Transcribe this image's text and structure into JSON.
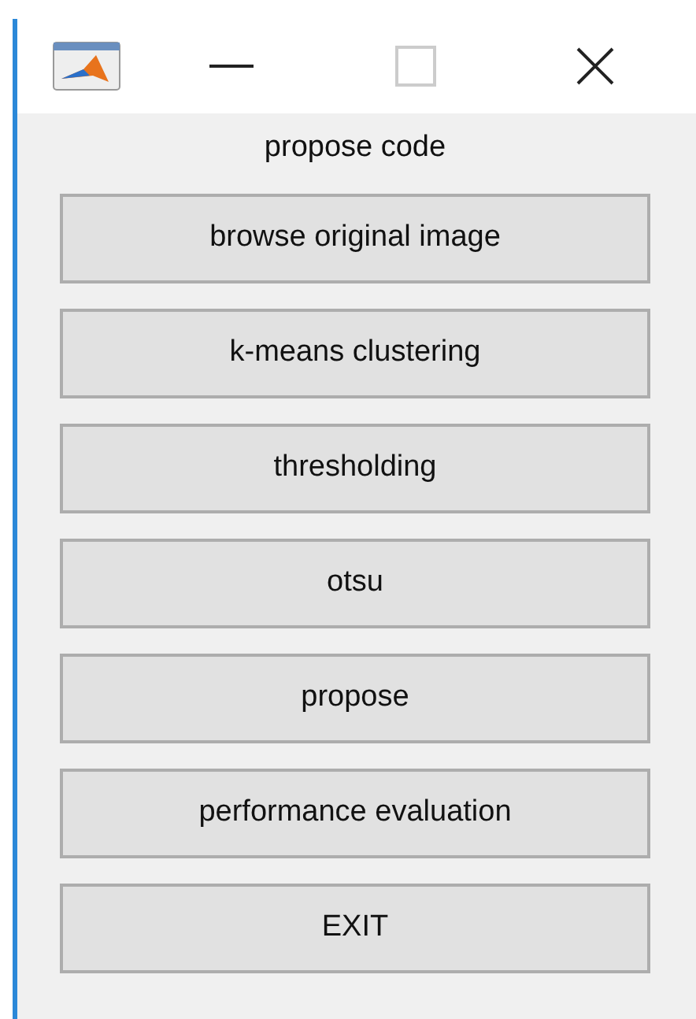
{
  "header": "propose code",
  "buttons": [
    {
      "label": "browse original image"
    },
    {
      "label": "k-means clustering"
    },
    {
      "label": "thresholding"
    },
    {
      "label": "otsu"
    },
    {
      "label": "propose"
    },
    {
      "label": "performance evaluation"
    },
    {
      "label": "EXIT"
    }
  ]
}
